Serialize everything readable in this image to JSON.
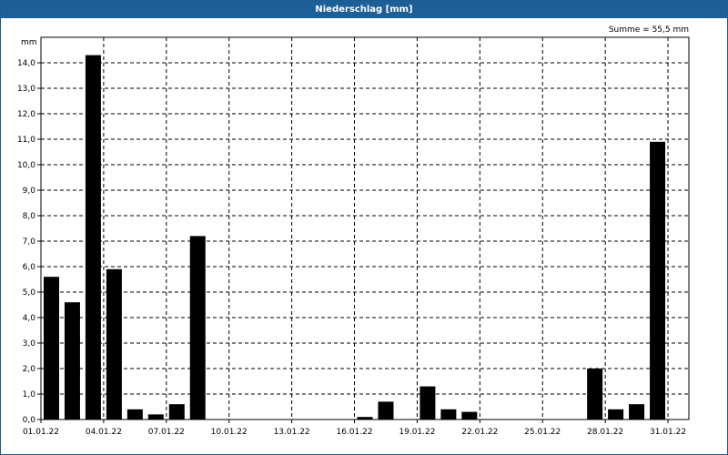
{
  "window": {
    "title": "Niederschlag [mm]"
  },
  "chart_data": {
    "type": "bar",
    "ylabel": "mm",
    "annotation": "Summe = 55,5 mm",
    "ylim": [
      0,
      15
    ],
    "yticks": [
      0,
      1,
      2,
      3,
      4,
      5,
      6,
      7,
      8,
      9,
      10,
      11,
      12,
      13,
      14
    ],
    "ytick_labels": [
      "0,0",
      "1,0",
      "2,0",
      "3,0",
      "4,0",
      "5,0",
      "6,0",
      "7,0",
      "8,0",
      "9,0",
      "10,0",
      "11,0",
      "12,0",
      "13,0",
      "14,0"
    ],
    "xtick_labels": [
      "01.01.22",
      "04.01.22",
      "07.01.22",
      "10.01.22",
      "13.01.22",
      "16.01.22",
      "19.01.22",
      "22.01.22",
      "25.01.22",
      "28.01.22",
      "31.01.22"
    ],
    "grid": true,
    "colors": {
      "bar": "#000000",
      "grid": "#000000",
      "title_bar": "#1f5f97"
    },
    "categories": [
      "01.01.22",
      "02.01.22",
      "03.01.22",
      "04.01.22",
      "05.01.22",
      "06.01.22",
      "07.01.22",
      "08.01.22",
      "09.01.22",
      "10.01.22",
      "11.01.22",
      "12.01.22",
      "13.01.22",
      "14.01.22",
      "15.01.22",
      "16.01.22",
      "17.01.22",
      "18.01.22",
      "19.01.22",
      "20.01.22",
      "21.01.22",
      "22.01.22",
      "23.01.22",
      "24.01.22",
      "25.01.22",
      "26.01.22",
      "27.01.22",
      "28.01.22",
      "29.01.22",
      "30.01.22",
      "31.01.22"
    ],
    "values": [
      5.6,
      4.6,
      14.3,
      5.9,
      0.4,
      0.2,
      0.6,
      7.2,
      0,
      0,
      0,
      0,
      0,
      0,
      0,
      0.1,
      0.7,
      0,
      1.3,
      0.4,
      0.3,
      0,
      0,
      0,
      0,
      0,
      2.0,
      0.4,
      0.6,
      10.9,
      0
    ]
  }
}
